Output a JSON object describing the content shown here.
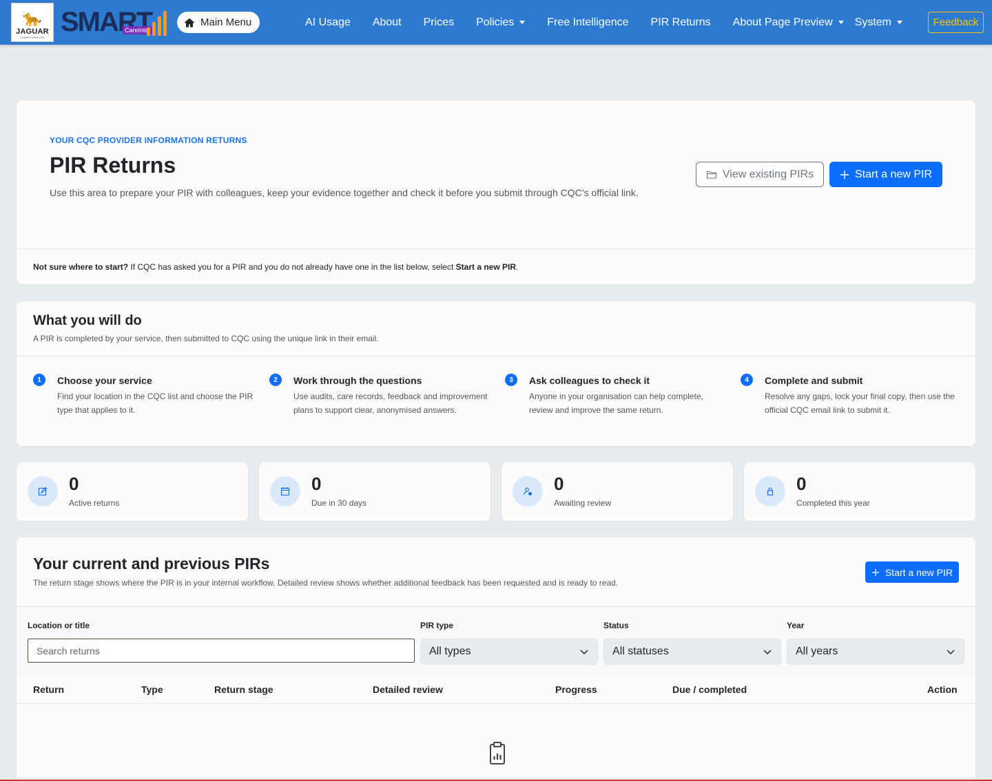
{
  "brand": {
    "jaguar_name": "JAGUAR",
    "jaguar_sub": "COMPUTERS LTD",
    "smart_word": "SMART",
    "careintel_label": "CareIntel"
  },
  "nav": {
    "main_menu": "Main Menu",
    "links": [
      {
        "label": "AI Usage",
        "dropdown": false
      },
      {
        "label": "About",
        "dropdown": false
      },
      {
        "label": "Prices",
        "dropdown": false
      },
      {
        "label": "Policies",
        "dropdown": true
      },
      {
        "label": "Free Intelligence",
        "dropdown": false
      },
      {
        "label": "PIR Returns",
        "dropdown": false
      },
      {
        "label": "About Page Preview",
        "dropdown": true
      },
      {
        "label": "System",
        "dropdown": true
      }
    ],
    "feedback": "Feedback"
  },
  "hero": {
    "kicker": "YOUR CQC PROVIDER INFORMATION RETURNS",
    "title": "PIR Returns",
    "lead": "Use this area to prepare your PIR with colleagues, keep your evidence together and check it before you submit through CQC’s official link.",
    "view_existing": "View existing PIRs",
    "start_new": "Start a new PIR",
    "note_bold": "Not sure where to start?",
    "note_text": " If CQC has asked you for a PIR and you do not already have one in the list below, select ",
    "note_bold2": "Start a new PIR",
    "note_end": "."
  },
  "steps": {
    "title": "What you will do",
    "subtitle": "A PIR is completed by your service, then submitted to CQC using the unique link in their email.",
    "items": [
      {
        "num": "1",
        "title": "Choose your service",
        "desc": "Find your location in the CQC list and choose the PIR type that applies to it."
      },
      {
        "num": "2",
        "title": "Work through the questions",
        "desc": "Use audits, care records, feedback and improvement plans to support clear, anonymised answers."
      },
      {
        "num": "3",
        "title": "Ask colleagues to check it",
        "desc": "Anyone in your organisation can help complete, review and improve the same return."
      },
      {
        "num": "4",
        "title": "Complete and submit",
        "desc": "Resolve any gaps, lock your final copy, then use the official CQC email link to submit it."
      }
    ]
  },
  "stats": [
    {
      "value": "0",
      "label": "Active returns",
      "icon": "edit-icon"
    },
    {
      "value": "0",
      "label": "Due in 30 days",
      "icon": "calendar-icon"
    },
    {
      "value": "0",
      "label": "Awaiting review",
      "icon": "user-check-icon"
    },
    {
      "value": "0",
      "label": "Completed this year",
      "icon": "lock-icon"
    }
  ],
  "pirs": {
    "title": "Your current and previous PIRs",
    "subtitle": "The return stage shows where the PIR is in your internal workflow. Detailed review shows whether additional feedback has been requested and is ready to read.",
    "start_new": "Start a new PIR",
    "filters": {
      "location_label": "Location or title",
      "search_placeholder": "Search returns",
      "type_label": "PIR type",
      "type_value": "All types",
      "status_label": "Status",
      "status_value": "All statuses",
      "year_label": "Year",
      "year_value": "All years"
    },
    "columns": [
      "Return",
      "Type",
      "Return stage",
      "Detailed review",
      "Progress",
      "Due / completed",
      "Action"
    ]
  },
  "colors": {
    "navbar": "#2c7bd1",
    "primary": "#0d6efd",
    "feedback": "#ffc107",
    "kicker": "#1a73e8"
  }
}
